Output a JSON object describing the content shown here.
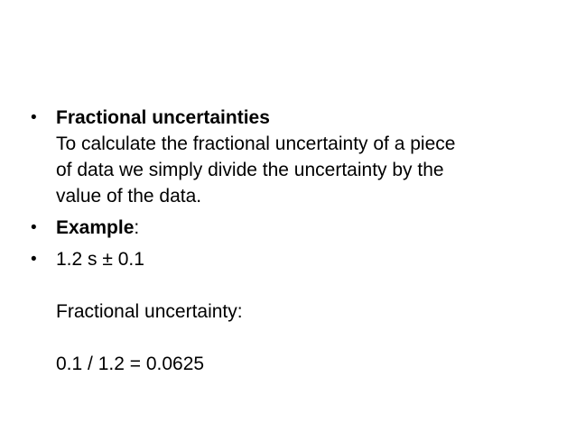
{
  "bullet_char": "•",
  "items": [
    {
      "heading": "Fractional uncertainties",
      "lines": [
        "To calculate the fractional uncertainty of a piece",
        "of data we simply divide the uncertainty by the",
        "value of the data."
      ]
    },
    {
      "heading": "Example",
      "suffix": ":"
    },
    {
      "lines": [
        "1.2 s ± 0.1",
        "",
        "Fractional uncertainty:",
        "",
        "0.1 / 1.2 = 0.0625"
      ]
    }
  ]
}
